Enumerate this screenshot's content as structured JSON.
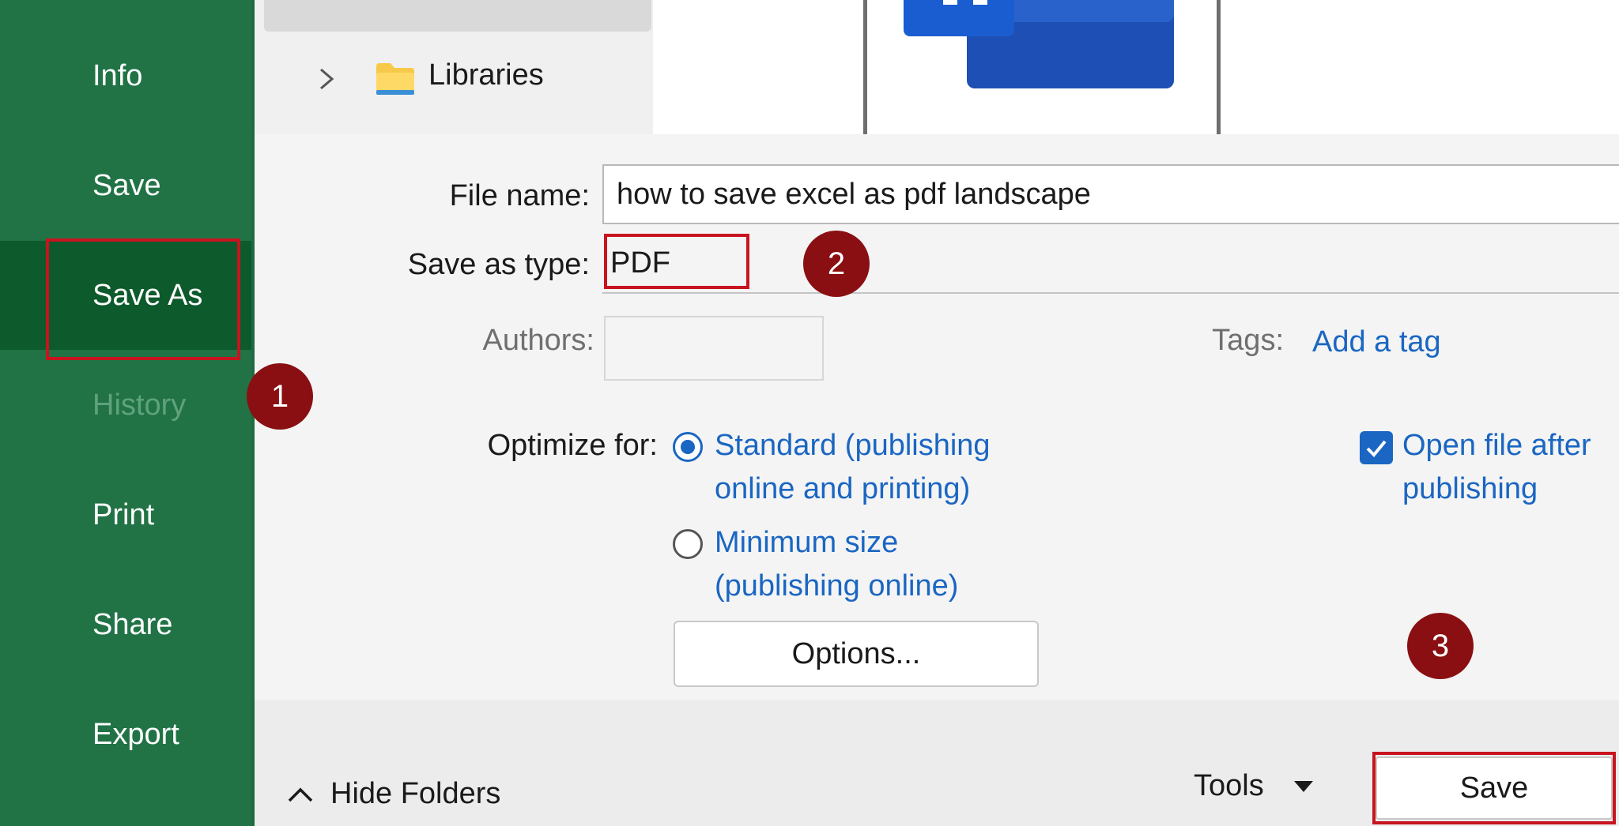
{
  "sidebar": {
    "items": [
      {
        "label": "Info"
      },
      {
        "label": "Save"
      },
      {
        "label": "Save As"
      },
      {
        "label": "History"
      },
      {
        "label": "Print"
      },
      {
        "label": "Share"
      },
      {
        "label": "Export"
      }
    ]
  },
  "annotations": {
    "step1": "1",
    "step2": "2",
    "step3": "3"
  },
  "tree": {
    "item_label": "Libraries"
  },
  "form": {
    "file_name_label": "File name:",
    "file_name_value": "how to save excel as pdf landscape",
    "save_type_label": "Save as type:",
    "save_type_value": "PDF",
    "authors_label": "Authors:",
    "authors_value": "",
    "tags_label": "Tags:",
    "tags_link": "Add a tag",
    "optimize_label": "Optimize for:",
    "option_standard_line1": "Standard (publishing",
    "option_standard_line2": "online and printing)",
    "option_minimum_line1": "Minimum size",
    "option_minimum_line2": "(publishing online)",
    "open_after_line1": "Open file after",
    "open_after_line2": "publishing",
    "options_button": "Options..."
  },
  "footer": {
    "hide_folders": "Hide Folders",
    "tools": "Tools",
    "save_button": "Save"
  },
  "colors": {
    "sidebar_green": "#217346",
    "sidebar_active": "#0d5a2c",
    "accent_blue": "#1a66c2",
    "annotation_red": "#c8141e",
    "badge_red": "#8a0f12"
  }
}
